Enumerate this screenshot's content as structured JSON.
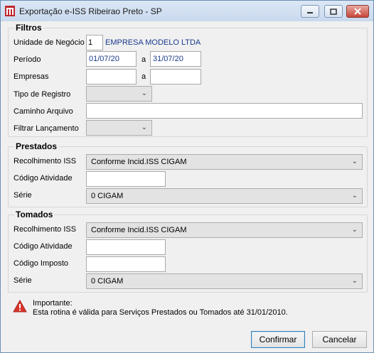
{
  "window": {
    "title": "Exportação e-ISS Ribeirao Preto - SP"
  },
  "filtros": {
    "title": "Filtros",
    "unidade_label": "Unidade de Negócio",
    "unidade_value": "1",
    "unidade_name": "EMPRESA MODELO LTDA",
    "periodo_label": "Período",
    "periodo_from": "01/07/20",
    "periodo_sep": "a",
    "periodo_to": "31/07/20",
    "empresas_label": "Empresas",
    "empresas_from": "",
    "empresas_sep": "a",
    "empresas_to": "",
    "tipo_label": "Tipo de Registro",
    "tipo_value": "",
    "caminho_label": "Caminho Arquivo",
    "caminho_value": "",
    "filtrar_label": "Filtrar Lançamento",
    "filtrar_value": ""
  },
  "prestados": {
    "title": "Prestados",
    "recolhimento_label": "Recolhimento ISS",
    "recolhimento_value": "Conforme Incid.ISS CIGAM",
    "codigo_atividade_label": "Código Atividade",
    "codigo_atividade_value": "",
    "serie_label": "Série",
    "serie_value": "0 CIGAM"
  },
  "tomados": {
    "title": "Tomados",
    "recolhimento_label": "Recolhimento ISS",
    "recolhimento_value": "Conforme Incid.ISS CIGAM",
    "codigo_atividade_label": "Código Atividade",
    "codigo_atividade_value": "",
    "codigo_imposto_label": "Código Imposto",
    "codigo_imposto_value": "",
    "serie_label": "Série",
    "serie_value": "0 CIGAM"
  },
  "notice": {
    "heading": "Importante:",
    "text": "Esta rotina é válida para Serviços Prestados ou Tomados até 31/01/2010."
  },
  "buttons": {
    "confirm": "Confirmar",
    "cancel": "Cancelar"
  },
  "colors": {
    "warning": "#d9342b",
    "date_text": "#1a3a8c",
    "titlebar": "#c9d9ee"
  }
}
